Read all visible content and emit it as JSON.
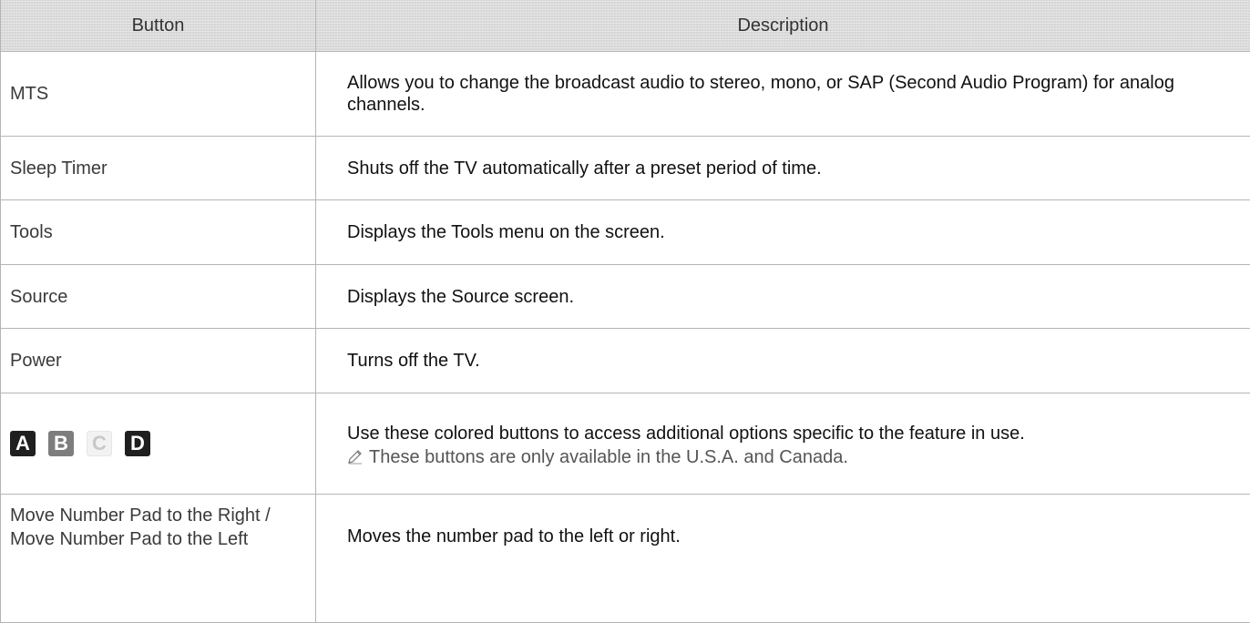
{
  "header": {
    "col1": "Button",
    "col2": "Description"
  },
  "rows": [
    {
      "button": "MTS",
      "description": "Allows you to change the broadcast audio to stereo, mono, or SAP (Second Audio Program) for analog channels."
    },
    {
      "button": "Sleep Timer",
      "description": "Shuts off the TV automatically after a preset period of time."
    },
    {
      "button": "Tools",
      "description": "Displays the Tools menu on the screen."
    },
    {
      "button": "Source",
      "description": "Displays the Source screen."
    },
    {
      "button": "Power",
      "description": "Turns off the TV."
    },
    {
      "keys": [
        "A",
        "B",
        "C",
        "D"
      ],
      "description": "Use these colored buttons to access additional options specific to the feature in use.",
      "note": "These buttons are only available in the U.S.A. and Canada."
    },
    {
      "button": "Move Number Pad to the Right / Move Number Pad to the Left",
      "description": "Moves the number pad to the left or right."
    }
  ],
  "colors": {
    "header_bg": "#dcdcdc",
    "border": "#b5b5b5",
    "key_dark": "#1f1f1f",
    "key_gray": "#7d7d7d",
    "key_light": "#f2f2f2"
  },
  "icons": {
    "note": "pencil-note-icon"
  }
}
